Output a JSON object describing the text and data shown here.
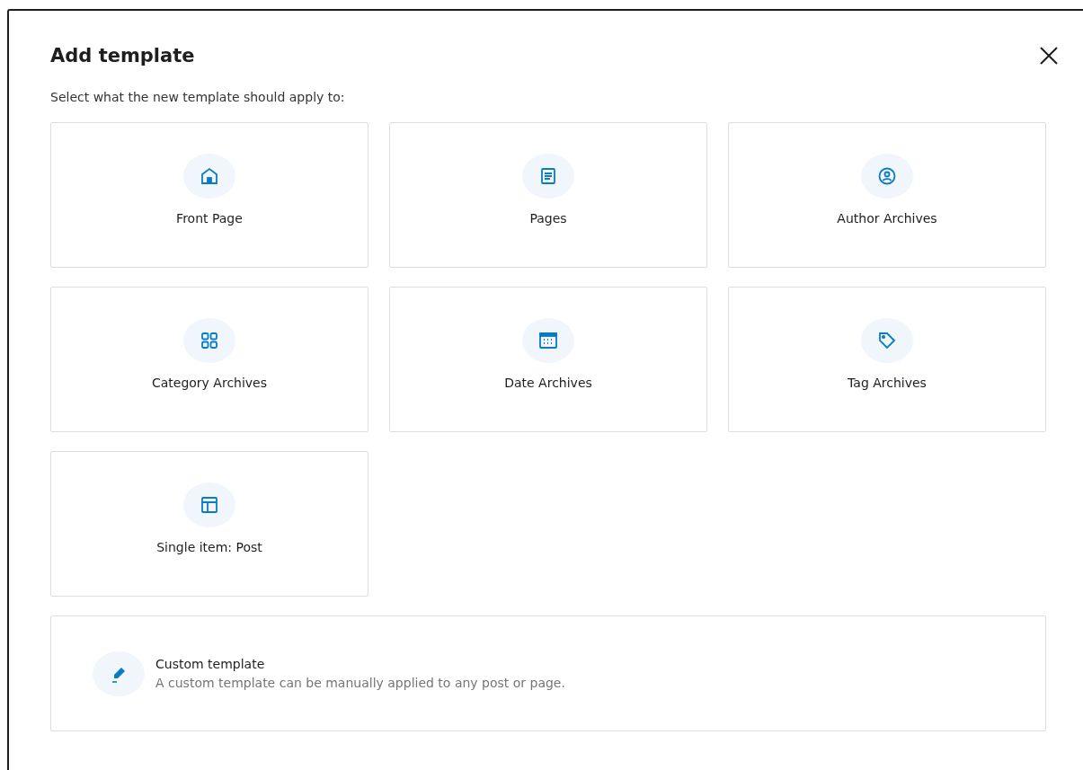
{
  "dialog": {
    "title": "Add template",
    "subtitle": "Select what the new template should apply to:"
  },
  "templates": [
    {
      "label": "Front Page",
      "kind": "home"
    },
    {
      "label": "Pages",
      "kind": "page"
    },
    {
      "label": "Author Archives",
      "kind": "author"
    },
    {
      "label": "Category Archives",
      "kind": "category"
    },
    {
      "label": "Date Archives",
      "kind": "date"
    },
    {
      "label": "Tag Archives",
      "kind": "tag"
    },
    {
      "label": "Single item: Post",
      "kind": "layout"
    }
  ],
  "custom": {
    "title": "Custom template",
    "description": "A custom template can be manually applied to any post or page."
  }
}
